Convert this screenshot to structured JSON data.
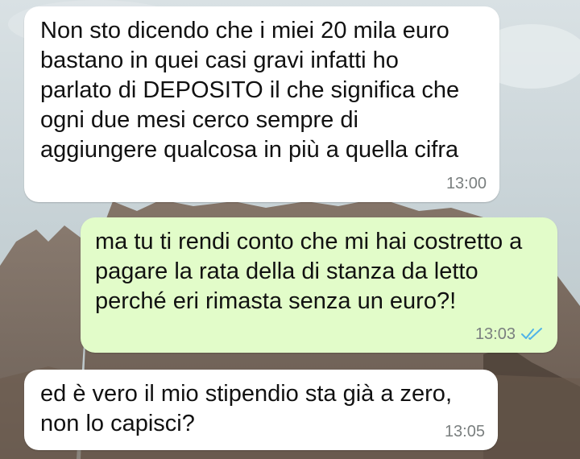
{
  "chat": {
    "messages": [
      {
        "direction": "incoming",
        "text": "Non sto dicendo che i miei 20 mila euro\nbastano in quei casi gravi infatti ho\nparlato di DEPOSITO il che significa che\nogni due mesi cerco sempre di\naggiungere qualcosa in più a quella cifra",
        "time": "13:00"
      },
      {
        "direction": "outgoing",
        "text": "ma tu ti rendi conto che mi hai costretto a\npagare la rata della di stanza da letto\nperché eri rimasta senza un euro?!",
        "time": "13:03",
        "status_icon": "double-check-icon",
        "status_color": "#4fb3e8"
      },
      {
        "direction": "incoming",
        "text": "ed è vero il mio stipendio sta già a zero,\nnon lo capisci?",
        "time": "13:05"
      }
    ]
  },
  "colors": {
    "incoming_bubble": "#ffffff",
    "outgoing_bubble": "#e2fcc9",
    "timestamp": "#7a7f7f"
  }
}
